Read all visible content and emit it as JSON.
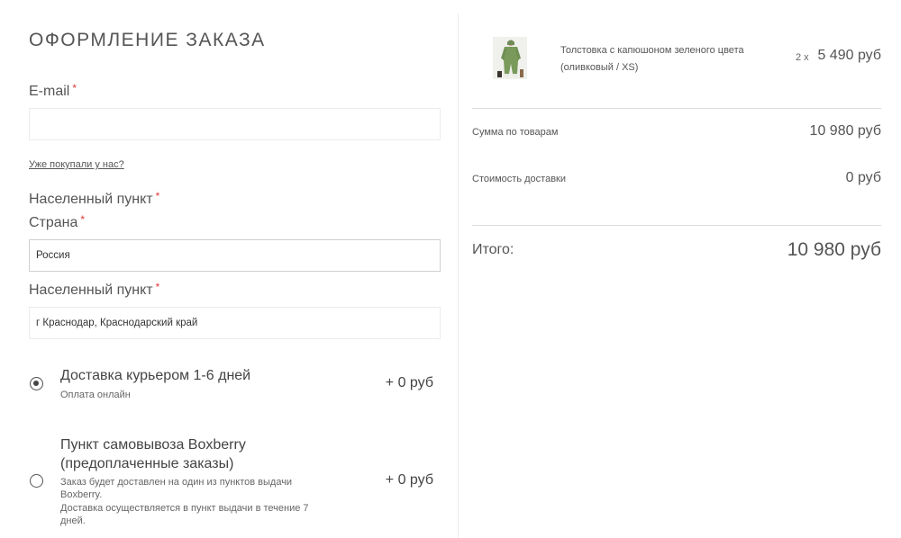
{
  "form": {
    "title": "ОФОРМЛЕНИЕ ЗАКАЗА",
    "email_label": "E-mail",
    "email_value": "",
    "already_bought_link": "Уже покупали у нас?",
    "locality_heading": "Населенный пункт",
    "country_label": "Страна",
    "country_value": "Россия",
    "locality_label": "Населенный пункт",
    "locality_value": "г Краснодар, Краснодарский край",
    "required_mark": "*"
  },
  "delivery": {
    "options": [
      {
        "title": "Доставка курьером 1-6 дней",
        "subtitle": "Оплата онлайн",
        "price": "+ 0 руб",
        "selected": true
      },
      {
        "title_line1": "Пункт самовывоза Boxberry",
        "title_line2": "(предоплаченные заказы)",
        "subtitle_line1": "Заказ будет доставлен на один из пунктов выдачи",
        "subtitle_line2": "Boxberry.",
        "subtitle_line3": "Доставка осуществляется в пункт выдачи в течение 7",
        "subtitle_line4": "дней.",
        "price": "+ 0 руб",
        "selected": false
      }
    ]
  },
  "cart": {
    "item": {
      "name_line1": "Толстовка с капюшоном зеленого цвета",
      "name_line2": "(оливковый / XS)",
      "qty": "2 x",
      "price": "5 490 руб",
      "image_icon": "hoodie-product-photo"
    },
    "subtotal_label": "Сумма по товарам",
    "subtotal_value": "10 980 руб",
    "shipping_label": "Стоимость доставки",
    "shipping_value": "0 руб",
    "total_label": "Итого:",
    "total_value": "10 980 руб"
  },
  "colors": {
    "required": "#e0383e",
    "text": "#444444",
    "border": "#ececec"
  }
}
